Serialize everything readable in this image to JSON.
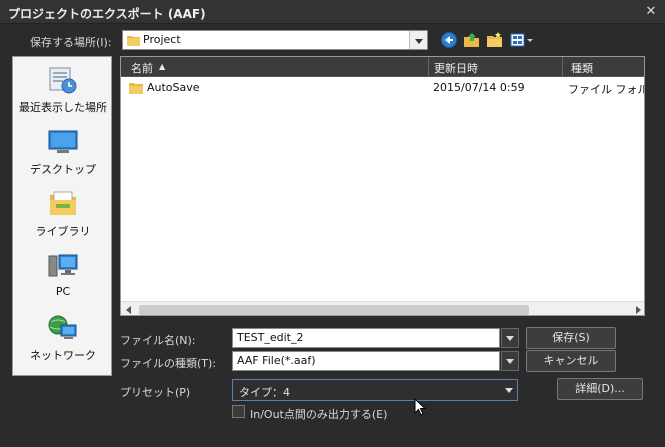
{
  "dialog": {
    "title": "プロジェクトのエクスポート (AAF)",
    "close": "✕"
  },
  "location": {
    "label": "保存する場所(I):",
    "value": "Project"
  },
  "toolbar": {
    "back": "back-icon",
    "up": "up-folder-icon",
    "new": "new-folder-icon",
    "view": "view-menu-icon"
  },
  "places": [
    {
      "label": "最近表示した場所",
      "icon": "recent-places-icon"
    },
    {
      "label": "デスクトップ",
      "icon": "desktop-icon"
    },
    {
      "label": "ライブラリ",
      "icon": "libraries-icon"
    },
    {
      "label": "PC",
      "icon": "computer-icon"
    },
    {
      "label": "ネットワーク",
      "icon": "network-icon"
    }
  ],
  "columns": {
    "name": "名前",
    "sort": "▲",
    "date": "更新日時",
    "type": "種類"
  },
  "files": [
    {
      "name": "AutoSave",
      "date": "2015/07/14 0:59",
      "type": "ファイル フォルダー"
    }
  ],
  "filename": {
    "label": "ファイル名(N):",
    "value": "TEST_edit_2"
  },
  "filetype": {
    "label": "ファイルの種類(T):",
    "value": "AAF File(*.aaf)"
  },
  "buttons": {
    "save": "保存(S)",
    "cancel": "キャンセル",
    "details": "詳細(D)..."
  },
  "preset": {
    "label": "プリセット(P)",
    "value": "タイプ：4"
  },
  "inout": {
    "label": "In/Out点間のみ出力する(E)",
    "checked": false
  }
}
